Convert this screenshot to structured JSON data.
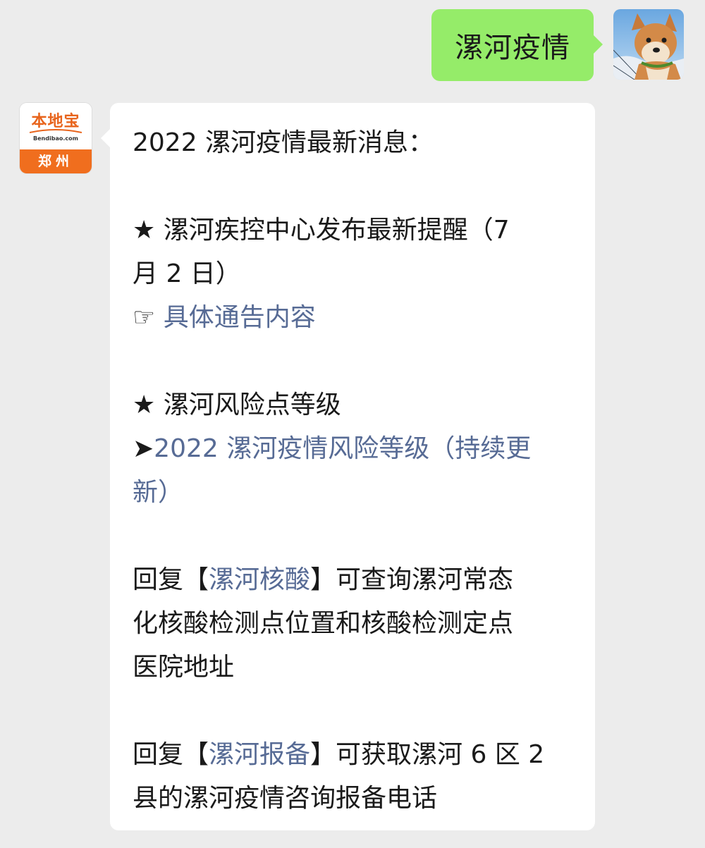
{
  "outgoing": {
    "text": "漯河疫情"
  },
  "incoming": {
    "title": "2022 漯河疫情最新消息：",
    "section1": {
      "star": "★",
      "heading_line1": " 漯河疾控中心发布最新提醒（7",
      "heading_line2": "月 2 日）",
      "pointer": "☞",
      "link": "具体通告内容"
    },
    "section2": {
      "star": "★",
      "heading": " 漯河风险点等级",
      "arrow": "➤",
      "link_line1": "2022 漯河疫情风险等级（持续更",
      "link_line2": "新）"
    },
    "section3": {
      "prefix": "回复【",
      "keyword": "漯河核酸",
      "suffix_line1": "】可查询漯河常态",
      "line2": "化核酸检测点位置和核酸检测定点",
      "line3": "医院地址"
    },
    "section4": {
      "prefix": "回复【",
      "keyword": "漯河报备",
      "suffix_line1": "】可获取漯河 6 区 2",
      "line2": "县的漯河疫情咨询报备电话"
    }
  },
  "account_logo": {
    "brand": "本地宝",
    "domain": "Bendibao.com",
    "city": "郑州",
    "color_orange": "#f06e1e"
  },
  "colors": {
    "outgoing_bubble": "#95ec69",
    "incoming_bubble": "#ffffff",
    "link": "#576b95",
    "background": "#ececec"
  }
}
